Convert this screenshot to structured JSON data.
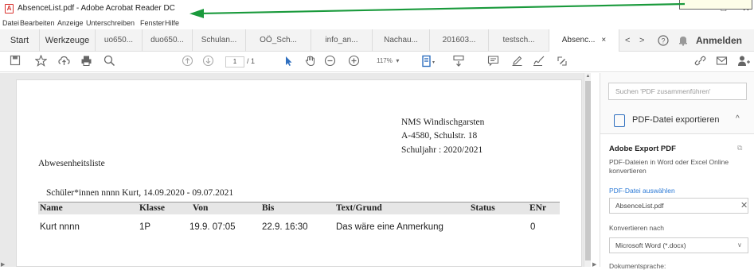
{
  "window": {
    "title": "AbsenceList.pdf - Adobe Acrobat Reader DC",
    "minimize": "–",
    "maximize": "□",
    "close": "✕",
    "app_icon_glyph": "A"
  },
  "menu": [
    "Datei",
    "Bearbeiten",
    "Anzeige",
    "Unterschreiben",
    "Fenster",
    "Hilfe"
  ],
  "tabs": {
    "home": "Start",
    "tools": "Werkzeuge",
    "documents": [
      "uo650...",
      "duo650...",
      "Schulan...",
      "OÖ_Sch...",
      "info_an...",
      "Nachau...",
      "201603...",
      "testsch..."
    ],
    "active": "Absenc...",
    "active_close": "×",
    "nav_prev": "<",
    "nav_next": ">",
    "help": "?",
    "bell": "🔔",
    "signin": "Anmelden"
  },
  "toolbar": {
    "page_current": "1",
    "page_total": "/ 1",
    "zoom": "117%"
  },
  "document": {
    "school_name": "NMS Windischgarsten",
    "school_address": "A-4580, Schulstr. 18",
    "school_year": "Schuljahr : 2020/2021",
    "title": "Abwesenheitsliste",
    "subtitle": "Schüler*innen nnnn Kurt, 14.09.2020 - 09.07.2021",
    "columns": [
      "Name",
      "Klasse",
      "Von",
      "Bis",
      "Text/Grund",
      "Status",
      "ENr"
    ],
    "rows": [
      [
        "Kurt nnnn",
        "1P",
        "19.9. 07:05",
        "22.9. 16:30",
        "Das wäre eine Anmerkung",
        "",
        "0"
      ]
    ]
  },
  "sidebar": {
    "search_placeholder": "Suchen 'PDF zusammenführen'",
    "export_label": "PDF-Datei exportieren",
    "panel_title": "Adobe Export PDF",
    "panel_desc": "PDF-Dateien in Word oder Excel Online konvertieren",
    "choose_file": "PDF-Datei auswählen",
    "file_name": "AbsenceList.pdf",
    "convert_label": "Konvertieren nach",
    "format_value": "Microsoft Word (*.docx)",
    "language_label": "Dokumentsprache:"
  },
  "colors": {
    "annotation_arrow": "#1a9a3c",
    "link_blue": "#2e7bd6",
    "acrobat_red": "#d8312d"
  }
}
